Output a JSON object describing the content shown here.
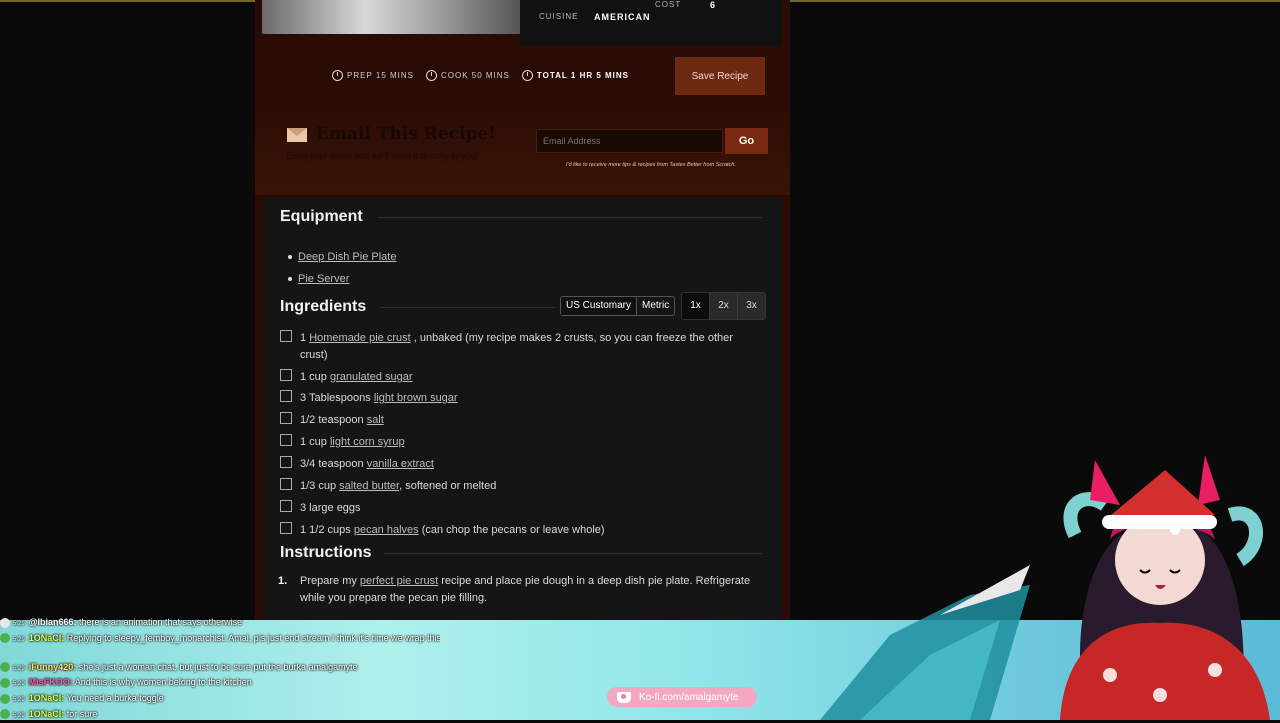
{
  "meta": {
    "cost_label": "COST",
    "cost_value": "6",
    "cuisine_label": "CUISINE",
    "cuisine_value": "AMERICAN"
  },
  "times": {
    "prep": "PREP 15 MINS",
    "cook": "COOK 50 MINS",
    "total": "TOTAL 1 HR 5 MINS"
  },
  "save_label": "Save Recipe",
  "email": {
    "title": "Email This Recipe!",
    "subtitle": "Enter your email and we'll send it directly to you!",
    "placeholder": "Email Address",
    "go_label": "Go",
    "consent": "I'd like to receive more tips & recipes from Tastes Better from Scratch."
  },
  "equipment": {
    "title": "Equipment",
    "items": [
      "Deep Dish Pie Plate",
      "Pie Server"
    ]
  },
  "ingredients": {
    "title": "Ingredients",
    "units": [
      "US Customary",
      "Metric"
    ],
    "scales": [
      "1x",
      "2x",
      "3x"
    ],
    "items": [
      {
        "amount": "1",
        "link": "Homemade pie crust",
        "note": ", unbaked (my recipe makes 2 crusts, so you can freeze the other crust)"
      },
      {
        "amount": "1 cup",
        "link": "granulated sugar",
        "note": ""
      },
      {
        "amount": "3 Tablespoons",
        "link": "light brown sugar",
        "note": ""
      },
      {
        "amount": "1/2 teaspoon",
        "link": "salt",
        "note": ""
      },
      {
        "amount": "1 cup",
        "link": "light corn syrup",
        "note": ""
      },
      {
        "amount": "3/4 teaspoon",
        "link": "vanilla extract",
        "note": ""
      },
      {
        "amount": "1/3 cup",
        "link": "salted butter",
        "note": ", softened or melted"
      },
      {
        "amount": "3 large eggs",
        "link": "",
        "note": ""
      },
      {
        "amount": "1 1/2 cups",
        "link": "pecan halves",
        "note": " (can chop the pecans or leave whole)"
      }
    ]
  },
  "instructions": {
    "title": "Instructions",
    "steps": [
      {
        "num": "1.",
        "pre": "Prepare my ",
        "link": "perfect pie crust",
        "post": " recipe and place pie dough in a deep dish pie plate. Refrigerate while you prepare the pecan pie filling."
      }
    ]
  },
  "chat": [
    {
      "time": "5:29",
      "name": "@Ibian666:",
      "msg": "there is an animation that says otherwise",
      "color": "#ffffff"
    },
    {
      "time": "5:29",
      "name": "1ONaCl:",
      "msg": "Replying to sleepy_femboy_monarchist: Amal, pls just end stream I think it's time we wrap this whole vtuber thing up, it's not looking good fam",
      "color": "#d9ff5a"
    },
    {
      "time": "5:29",
      "name": "iFunny420:",
      "msg": "she's just a woman chat, but just to be sure put the burka amalgamyte",
      "color": "#ffe066"
    },
    {
      "time": "5:29",
      "name": "MisFKOO:",
      "msg": "And this is why women belong to the kitchen",
      "color": "#ff5aa8"
    },
    {
      "time": "5:29",
      "name": "1ONaCl:",
      "msg": "You need a burka toggle",
      "color": "#d9ff5a"
    },
    {
      "time": "5:29",
      "name": "1ONaCl:",
      "msg": "for sure",
      "color": "#d9ff5a"
    }
  ],
  "kofi": "Ko-fi.com/amalgamyte",
  "colors": {
    "page_bg": "#2a0c04",
    "card_bg": "#151515",
    "accent": "#6e2a10"
  }
}
